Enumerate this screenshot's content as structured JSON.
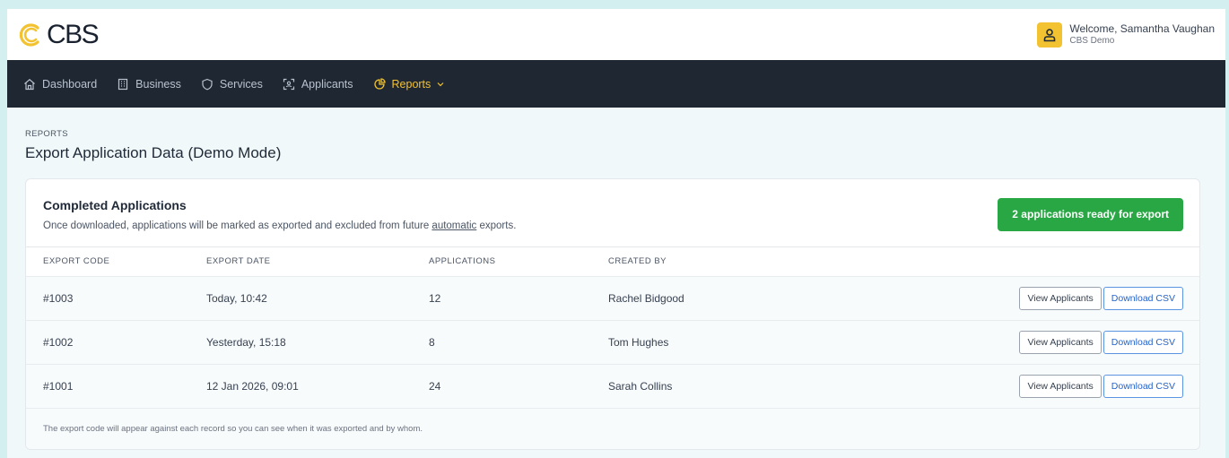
{
  "header": {
    "logo_text": "CBS",
    "welcome": "Welcome, Samantha Vaughan",
    "org": "CBS Demo"
  },
  "nav": {
    "items": [
      {
        "label": "Dashboard",
        "icon": "home-icon"
      },
      {
        "label": "Business",
        "icon": "building-icon"
      },
      {
        "label": "Services",
        "icon": "shield-icon"
      },
      {
        "label": "Applicants",
        "icon": "scan-user-icon"
      },
      {
        "label": "Reports",
        "icon": "reports-icon",
        "active": true
      }
    ],
    "active_color": "#f2c230"
  },
  "page": {
    "eyebrow": "REPORTS",
    "title": "Export Application Data (Demo Mode)"
  },
  "card": {
    "title": "Completed Applications",
    "subtitle_before": "Once downloaded, applications will be marked as exported and excluded from future ",
    "subtitle_link": "automatic",
    "subtitle_after": " exports.",
    "badge": "2 applications ready for export",
    "badge_color": "#29a745"
  },
  "table": {
    "columns": [
      "EXPORT CODE",
      "EXPORT DATE",
      "APPLICATIONS",
      "CREATED BY"
    ],
    "rows": [
      {
        "code": "#1003",
        "date": "Today, 10:42",
        "applications": "12",
        "created_by": "Rachel Bidgood"
      },
      {
        "code": "#1002",
        "date": "Yesterday, 15:18",
        "applications": "8",
        "created_by": "Tom Hughes"
      },
      {
        "code": "#1001",
        "date": "12 Jan 2026, 09:01",
        "applications": "24",
        "created_by": "Sarah Collins"
      }
    ],
    "view_label": "View Applicants",
    "download_label": "Download CSV"
  },
  "footnote": "The export code will appear against each record so you can see when it was exported and by whom."
}
